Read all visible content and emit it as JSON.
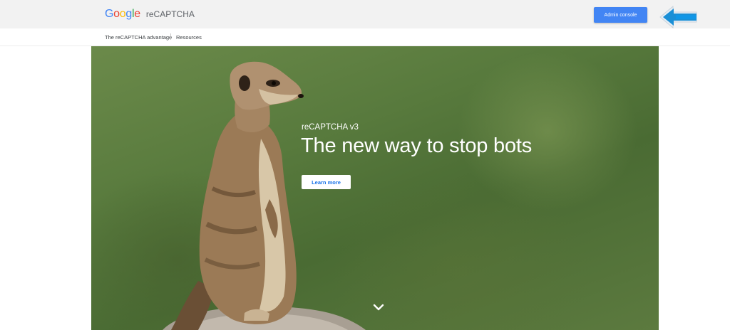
{
  "header": {
    "logo_letters": [
      {
        "char": "G",
        "color": "#4285f4"
      },
      {
        "char": "o",
        "color": "#ea4335"
      },
      {
        "char": "o",
        "color": "#fbbc05"
      },
      {
        "char": "g",
        "color": "#4285f4"
      },
      {
        "char": "l",
        "color": "#34a853"
      },
      {
        "char": "e",
        "color": "#ea4335"
      }
    ],
    "product_name": "reCAPTCHA",
    "admin_button_label": "Admin console",
    "admin_button_color": "#4285f4",
    "pointer_arrow_icon": "arrow-left-icon",
    "pointer_arrow_color": "#1a8fd6"
  },
  "subnav": {
    "items": [
      {
        "label": "The reCAPTCHA advantage"
      },
      {
        "label": "Resources"
      }
    ]
  },
  "hero": {
    "kicker": "reCAPTCHA v3",
    "title": "The new way to stop bots",
    "cta_label": "Learn more",
    "scroll_icon": "chevron-down-icon"
  }
}
